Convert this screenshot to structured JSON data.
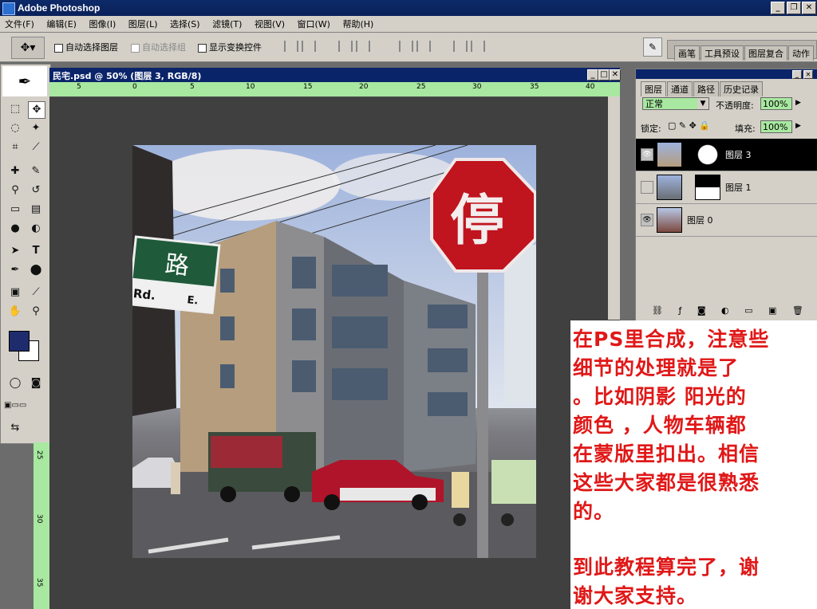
{
  "app": {
    "title": "Adobe Photoshop"
  },
  "menu": [
    "文件(F)",
    "编辑(E)",
    "图像(I)",
    "图层(L)",
    "选择(S)",
    "滤镜(T)",
    "视图(V)",
    "窗口(W)",
    "帮助(H)"
  ],
  "options": {
    "auto_select_layer": "自动选择图层",
    "auto_select_group": "自动选择组",
    "show_transform": "显示变换控件"
  },
  "palette_well": {
    "tabs": [
      "画笔",
      "工具预设",
      "图层复合",
      "动作"
    ]
  },
  "document": {
    "title": "民宅.psd @ 50% (图层 3, RGB/8)",
    "ruler_h": [
      "5",
      "0",
      "5",
      "10",
      "15",
      "20",
      "25",
      "30",
      "35",
      "40"
    ],
    "ruler_v": [
      "25",
      "30",
      "35"
    ]
  },
  "layers_panel": {
    "tabs": [
      "图层",
      "通道",
      "路径",
      "历史记录"
    ],
    "blend_mode": "正常",
    "opacity_label": "不透明度:",
    "opacity": "100%",
    "lock_label": "锁定:",
    "fill_label": "填充:",
    "fill": "100%",
    "layers": [
      {
        "name": "图层 3",
        "selected": true
      },
      {
        "name": "图层 1",
        "selected": false
      },
      {
        "name": "图层 0",
        "selected": false
      }
    ]
  },
  "note": {
    "lines": [
      "在PS里合成，注意些",
      "细节的处理就是了",
      "。比如阴影 阳光的",
      "颜色 ，人物车辆都",
      "在蒙版里扣出。相信",
      "这些大家都是很熟悉",
      "的。",
      "到此教程算完了，谢",
      "谢大家支持。"
    ]
  },
  "photo": {
    "sign_text": "停",
    "street_sign": "路",
    "street_sub_left": "Rd.",
    "street_sub_right": "E."
  },
  "colors": {
    "foreground": "#1e2c6e",
    "background": "#ffffff",
    "note_text": "#e01818",
    "title_bar": "#0a246a"
  }
}
